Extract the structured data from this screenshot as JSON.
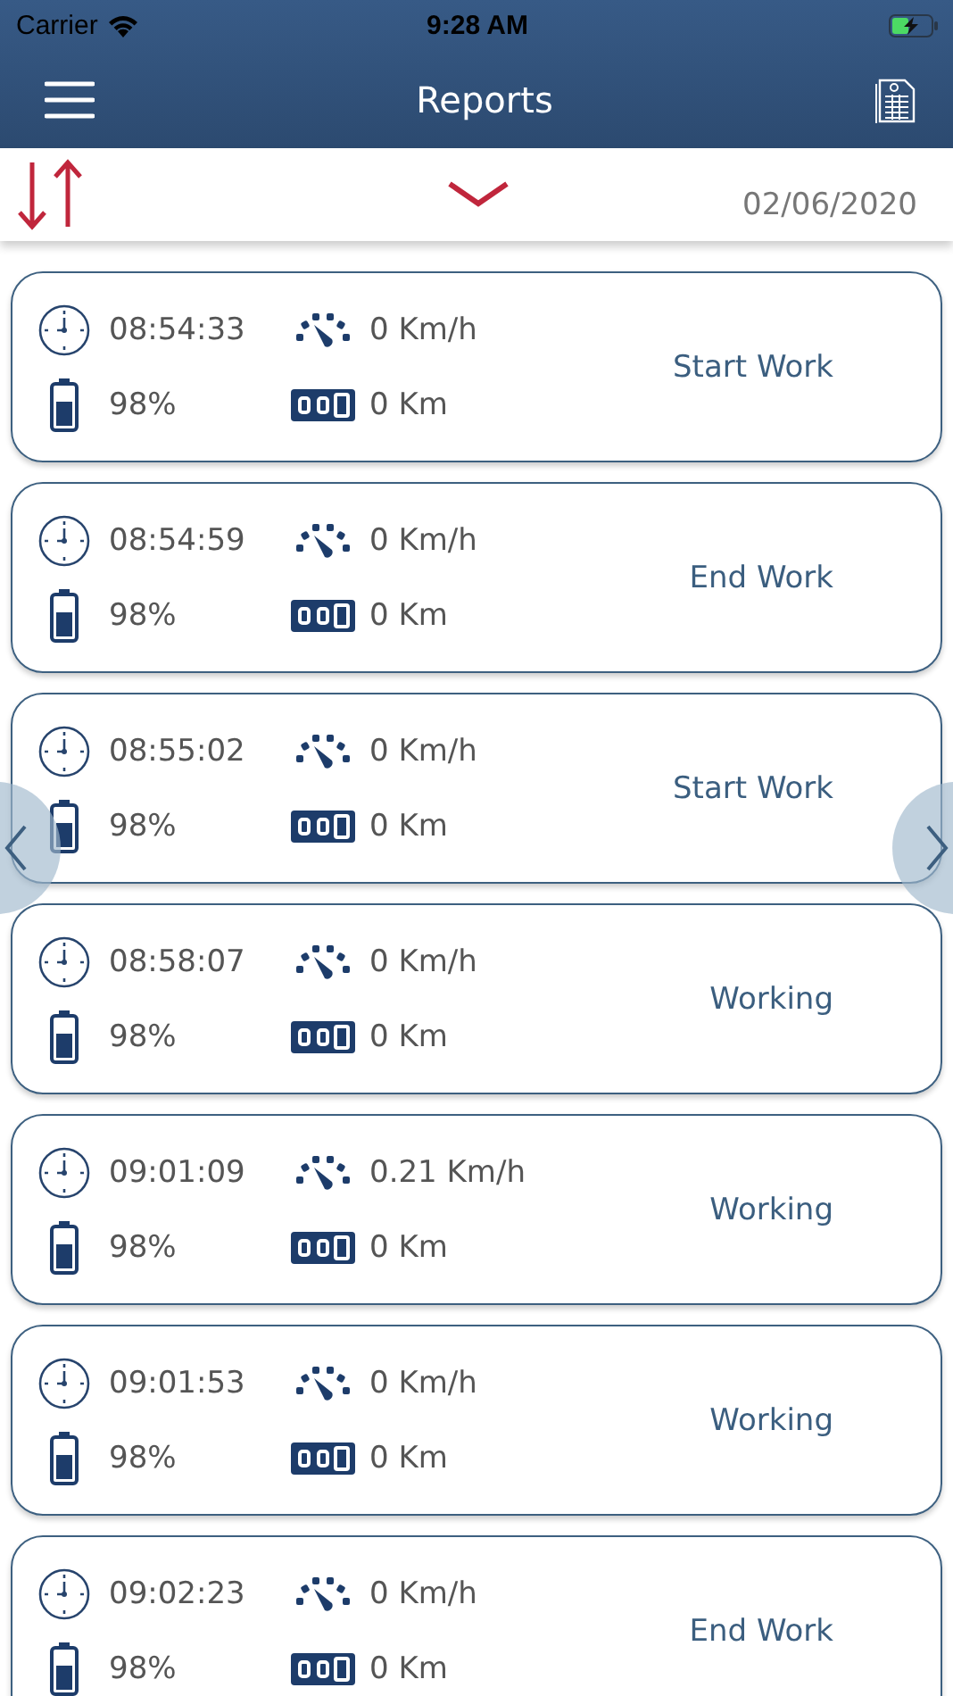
{
  "status_bar": {
    "carrier": "Carrier",
    "time": "9:28 AM",
    "battery_charging": true
  },
  "nav": {
    "title": "Reports"
  },
  "toolbar": {
    "date": "02/06/2020"
  },
  "reports": [
    {
      "time": "08:54:33",
      "speed": "0 Km/h",
      "battery": "98%",
      "distance": "0 Km",
      "status": "Start Work"
    },
    {
      "time": "08:54:59",
      "speed": "0 Km/h",
      "battery": "98%",
      "distance": "0 Km",
      "status": "End Work"
    },
    {
      "time": "08:55:02",
      "speed": "0 Km/h",
      "battery": "98%",
      "distance": "0 Km",
      "status": "Start Work"
    },
    {
      "time": "08:58:07",
      "speed": "0 Km/h",
      "battery": "98%",
      "distance": "0 Km",
      "status": "Working"
    },
    {
      "time": "09:01:09",
      "speed": "0.21 Km/h",
      "battery": "98%",
      "distance": "0 Km",
      "status": "Working"
    },
    {
      "time": "09:01:53",
      "speed": "0 Km/h",
      "battery": "98%",
      "distance": "0 Km",
      "status": "Working"
    },
    {
      "time": "09:02:23",
      "speed": "0 Km/h",
      "battery": "98%",
      "distance": "0 Km",
      "status": "End Work"
    }
  ]
}
